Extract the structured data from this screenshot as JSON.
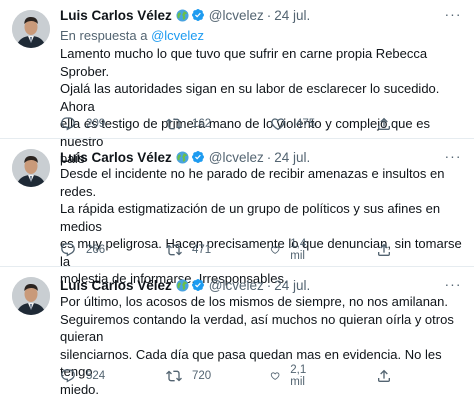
{
  "tweets": [
    {
      "author": {
        "name": "Luis Carlos Vélez",
        "handle": "@lcvelez"
      },
      "date": "24 jul.",
      "separator": "·",
      "reply_to": {
        "prefix": "En respuesta a ",
        "mention": "@lcvelez"
      },
      "lines": [
        "Lamento mucho lo que tuvo que sufrir en carne propia Rebecca Sprober.",
        "Ojalá las autoridades sigan en su labor de esclarecer lo sucedido. Ahora",
        "ella es testigo de primera mano de lo violento y complejo que es nuestro",
        "país"
      ],
      "replies": "209",
      "retweets": "162",
      "likes": "475",
      "share": ""
    },
    {
      "author": {
        "name": "Luis Carlos Vélez",
        "handle": "@lcvelez"
      },
      "date": "24 jul.",
      "separator": "·",
      "lines": [
        "Desde el incidente no he parado de recibir amenazas e insultos en redes.",
        "La rápida estigmatización de un grupo de políticos y sus afines en medios",
        "es muy peligrosa. Hacen precisamente lo que denuncian, sin tomarse la",
        "molestia de informarse. Irresponsables."
      ],
      "replies": "266",
      "retweets": "471",
      "likes": "1,4 mil",
      "share": ""
    },
    {
      "author": {
        "name": "Luis Carlos Vélez",
        "handle": "@lcvelez"
      },
      "date": "24 jul.",
      "separator": "·",
      "lines": [
        "Por último, los acosos de los mismos de siempre, no nos amilanan.",
        "Seguiremos contando la verdad, así muchos no quieran oírla y otros quieran",
        "silenciarnos. Cada día que pasa quedan mas en evidencia.  No les tengo",
        "miedo."
      ],
      "replies": "524",
      "retweets": "720",
      "likes": "2,1 mil",
      "share": ""
    }
  ],
  "colors": {
    "text": "#0f1419",
    "secondary": "#536471",
    "link": "#1d9bf0",
    "verified": "#1d9bf0",
    "divider": "#e6ecf0"
  },
  "icons": [
    "globe-emoji-icon",
    "verified-badge-icon",
    "more-icon",
    "reply-icon",
    "retweet-icon",
    "like-icon",
    "share-icon"
  ]
}
